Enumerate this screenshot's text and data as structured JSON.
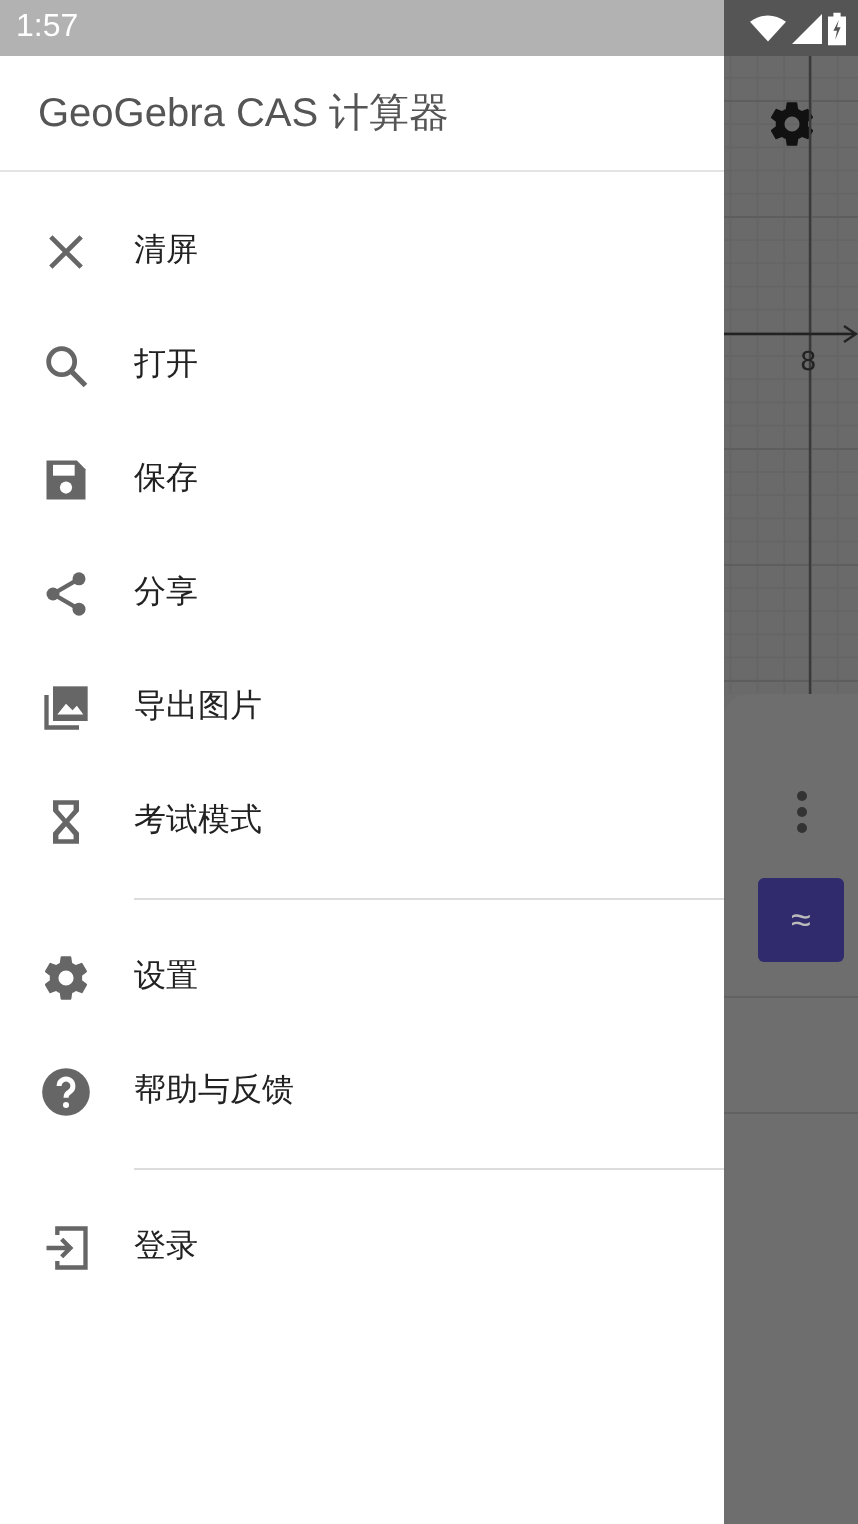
{
  "status_bar": {
    "time": "1:57"
  },
  "drawer": {
    "title": "GeoGebra CAS 计算器",
    "groups": [
      {
        "items": [
          {
            "label": "清屏",
            "kind": "close"
          },
          {
            "label": "打开",
            "kind": "search"
          },
          {
            "label": "保存",
            "kind": "save"
          },
          {
            "label": "分享",
            "kind": "share"
          },
          {
            "label": "导出图片",
            "kind": "image"
          },
          {
            "label": "考试模式",
            "kind": "hourglass"
          }
        ]
      },
      {
        "items": [
          {
            "label": "设置",
            "kind": "gear"
          },
          {
            "label": "帮助与反馈",
            "kind": "help"
          }
        ]
      },
      {
        "items": [
          {
            "label": "登录",
            "kind": "login"
          }
        ]
      }
    ]
  },
  "background_app": {
    "axis_label": "8",
    "approx_button": "≈"
  }
}
